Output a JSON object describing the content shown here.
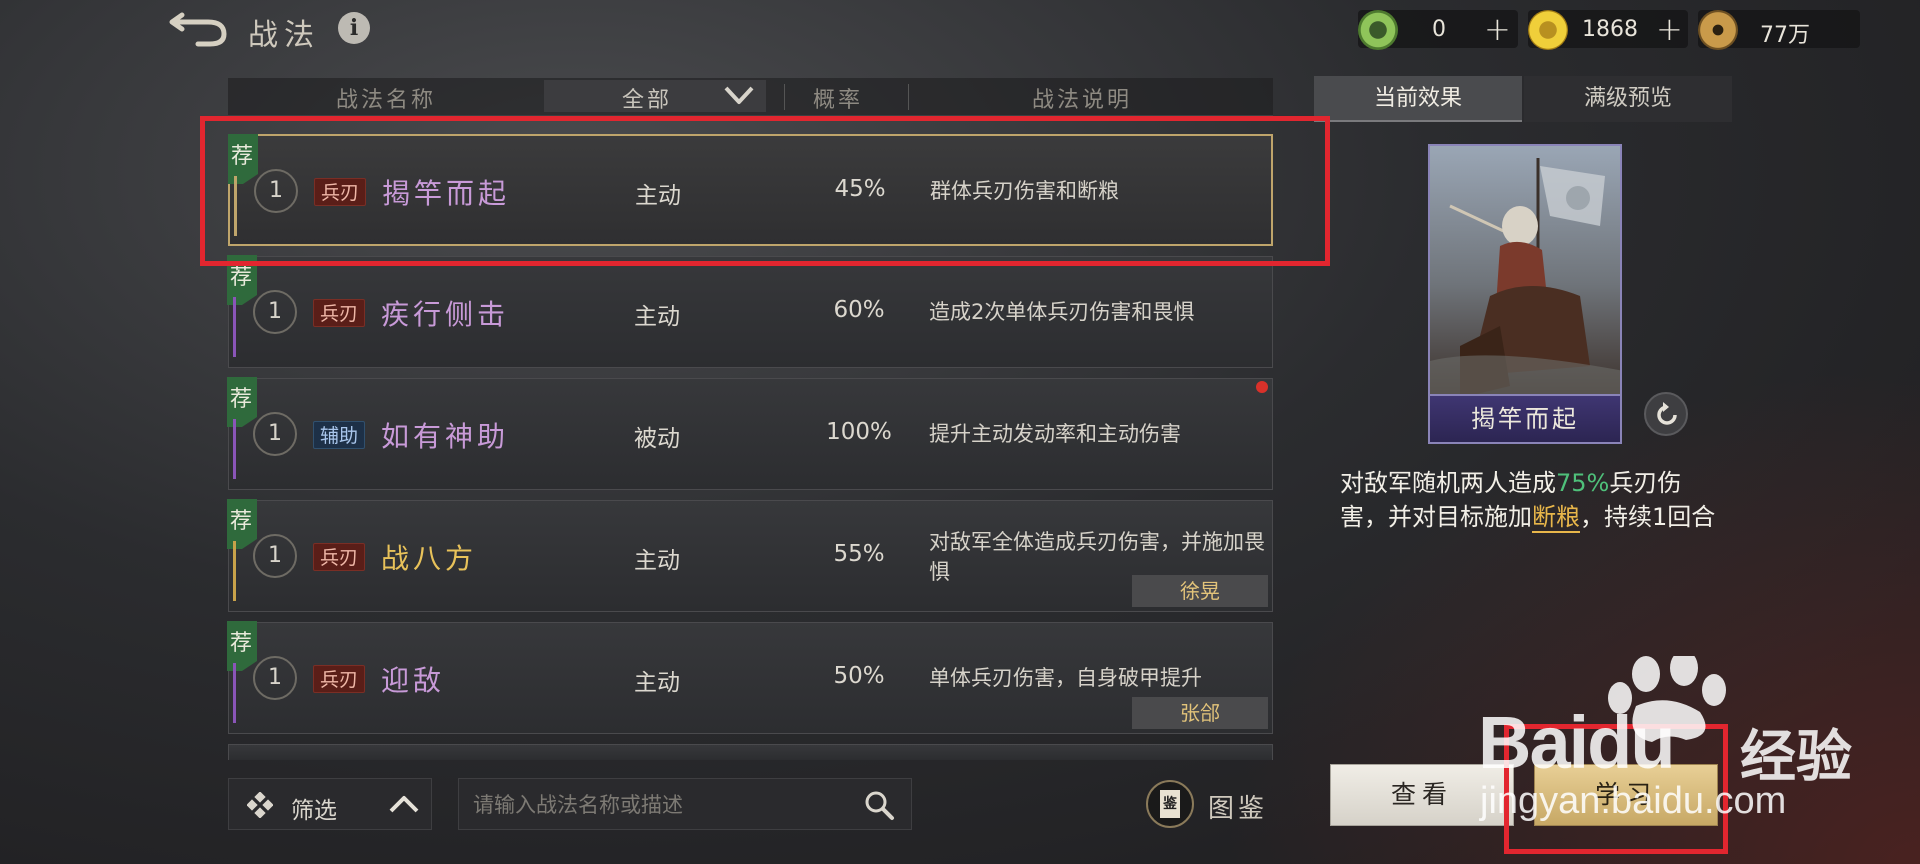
{
  "header": {
    "title": "战法",
    "info_label": "i"
  },
  "currencies": [
    {
      "icon": "jade-coin-icon",
      "value": "0",
      "plus": "+"
    },
    {
      "icon": "gold-coin-icon",
      "value": "1868",
      "plus": "+"
    },
    {
      "icon": "copper-coin-icon",
      "value": "77万"
    }
  ],
  "table": {
    "col_name": "战法名称",
    "filter_label": "全部",
    "col_rate": "概率",
    "col_desc": "战法说明"
  },
  "rows": [
    {
      "rec": "荐",
      "level": "1",
      "tag": "兵刃",
      "tag_kind": "blade",
      "name": "揭竿而起",
      "name_color": "#c89ad8",
      "kind": "主动",
      "rate": "45%",
      "desc": "群体兵刃伤害和断粮",
      "owner": ""
    },
    {
      "rec": "荐",
      "level": "1",
      "tag": "兵刃",
      "tag_kind": "blade",
      "name": "疾行侧击",
      "name_color": "#c89ad8",
      "kind": "主动",
      "rate": "60%",
      "desc": "造成2次单体兵刃伤害和畏惧",
      "owner": ""
    },
    {
      "rec": "荐",
      "level": "1",
      "tag": "辅助",
      "tag_kind": "assist",
      "name": "如有神助",
      "name_color": "#c89ad8",
      "kind": "被动",
      "rate": "100%",
      "desc": "提升主动发动率和主动伤害",
      "owner": ""
    },
    {
      "rec": "荐",
      "level": "1",
      "tag": "兵刃",
      "tag_kind": "blade",
      "name": "战八方",
      "name_color": "#e8c25a",
      "kind": "主动",
      "rate": "55%",
      "desc": "对敌军全体造成兵刃伤害，并施加畏惧",
      "owner": "徐晃"
    },
    {
      "rec": "荐",
      "level": "1",
      "tag": "兵刃",
      "tag_kind": "blade",
      "name": "迎敌",
      "name_color": "#c89ad8",
      "kind": "主动",
      "rate": "50%",
      "desc": "单体兵刃伤害，自身破甲提升",
      "owner": "张郃"
    }
  ],
  "bottom": {
    "filter_label": "筛选",
    "search_placeholder": "请输入战法名称或描述",
    "codex_icon_char": "鉴",
    "codex_label": "图鉴"
  },
  "panel": {
    "tab_current": "当前效果",
    "tab_max": "满级预览",
    "card_name": "揭竿而起",
    "effect": {
      "part1": "对敌军随机两人造成",
      "pct": "75%",
      "part2": "兵刃伤害，并对目标施加",
      "status": "断粮",
      "part3": "，持续1回合"
    },
    "view_label": "查看",
    "learn_label": "学习"
  },
  "watermark": {
    "brand": "Bai",
    "brand2": "du",
    "cn": "经验",
    "url": "jingyan.baidu.com"
  },
  "colors": {
    "highlight": "#e2262f",
    "recommend_flag": "#2f6a3c",
    "gold_frame": "#bfa56b"
  }
}
